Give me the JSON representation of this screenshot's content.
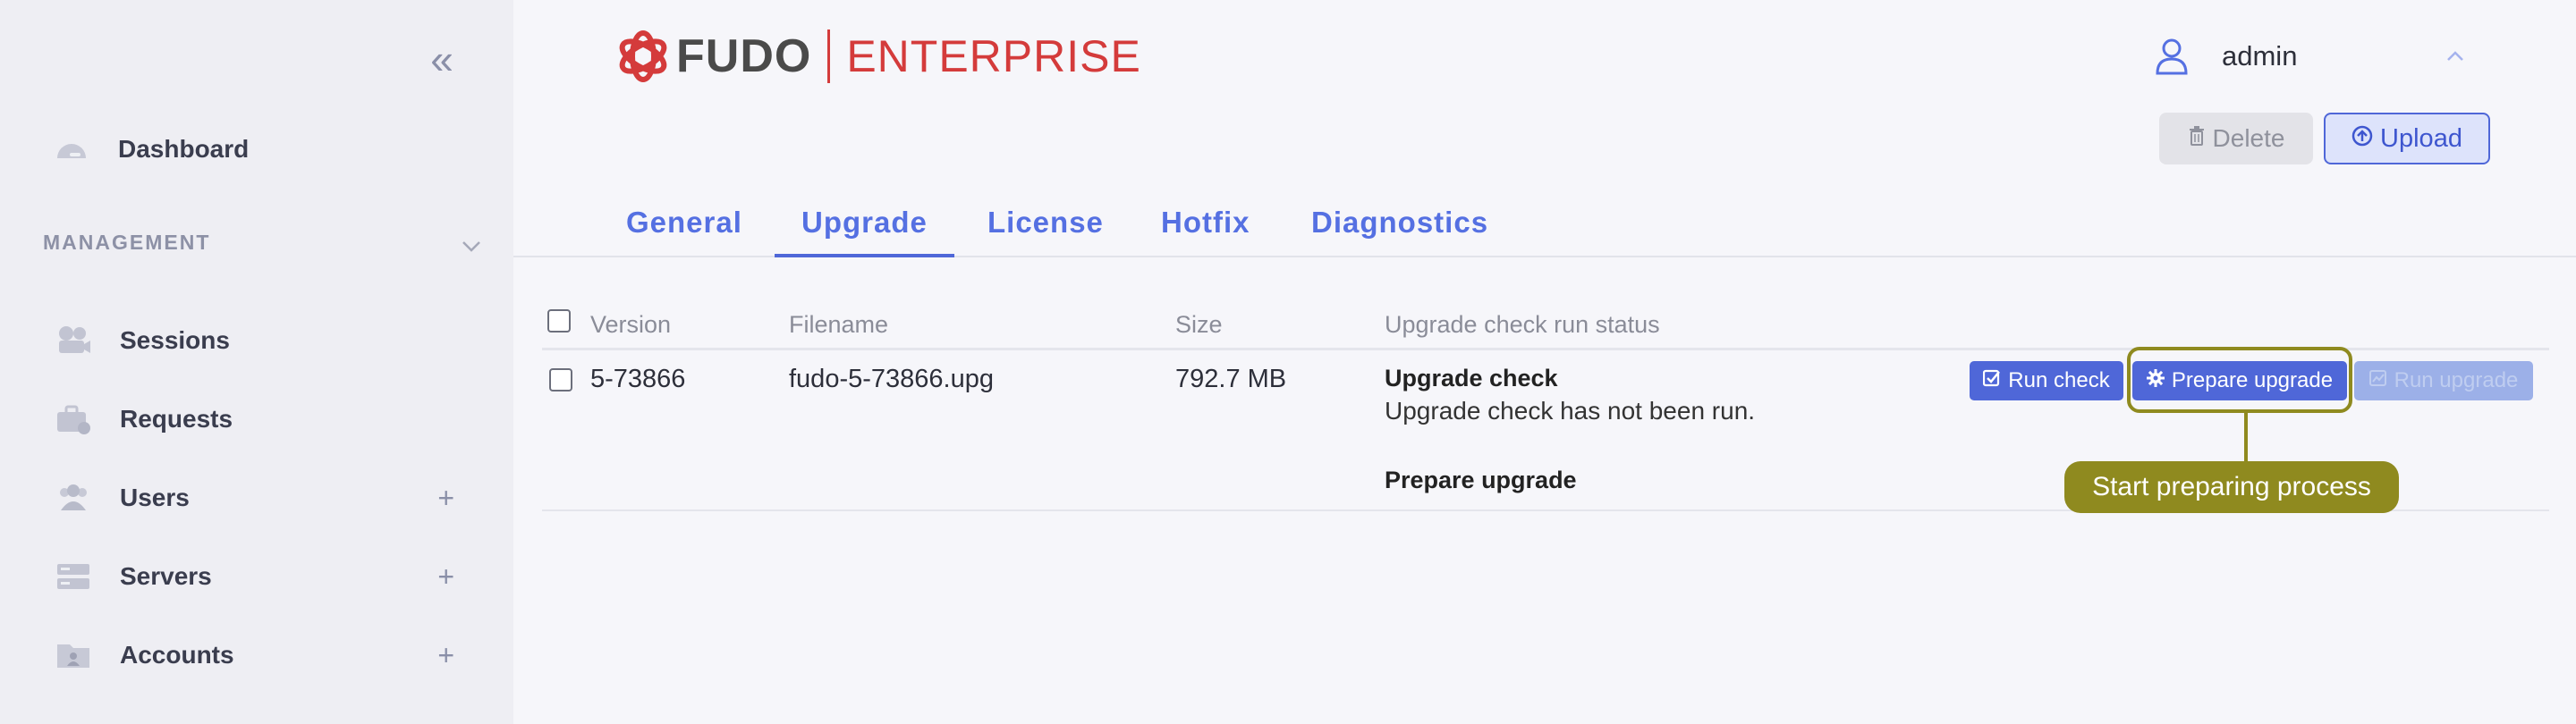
{
  "sidebar": {
    "collapse_glyph": "«",
    "dashboard": {
      "label": "Dashboard",
      "icon": "dashboard-icon"
    },
    "section": {
      "label": "MANAGEMENT"
    },
    "items": [
      {
        "label": "Sessions",
        "icon": "camera-icon",
        "has_add": false
      },
      {
        "label": "Requests",
        "icon": "briefcase-icon",
        "has_add": false
      },
      {
        "label": "Users",
        "icon": "users-icon",
        "has_add": true
      },
      {
        "label": "Servers",
        "icon": "server-icon",
        "has_add": true
      },
      {
        "label": "Accounts",
        "icon": "account-folder-icon",
        "has_add": true
      }
    ],
    "add_glyph": "+"
  },
  "header": {
    "logo_fudo": "FUDO",
    "logo_enterprise": "ENTERPRISE",
    "user_name": "admin",
    "brand_color": "#d43b3b",
    "accent_color": "#4f67d8"
  },
  "toolbar": {
    "delete_label": "Delete",
    "upload_label": "Upload"
  },
  "tabs": [
    {
      "label": "General",
      "active": false
    },
    {
      "label": "Upgrade",
      "active": true
    },
    {
      "label": "License",
      "active": false
    },
    {
      "label": "Hotfix",
      "active": false
    },
    {
      "label": "Diagnostics",
      "active": false
    }
  ],
  "table": {
    "columns": [
      "Version",
      "Filename",
      "Size",
      "Upgrade check run status"
    ],
    "rows": [
      {
        "version": "5-73866",
        "filename": "fudo-5-73866.upg",
        "size": "792.7 MB",
        "status_title": "Upgrade check",
        "status_text": "Upgrade check has not been run.",
        "prepare_title": "Prepare upgrade",
        "actions": {
          "run_check": "Run check",
          "prepare_upgrade": "Prepare upgrade",
          "run_upgrade": "Run upgrade"
        }
      }
    ]
  },
  "callout": {
    "text": "Start preparing process",
    "color": "#8f8a1f"
  }
}
